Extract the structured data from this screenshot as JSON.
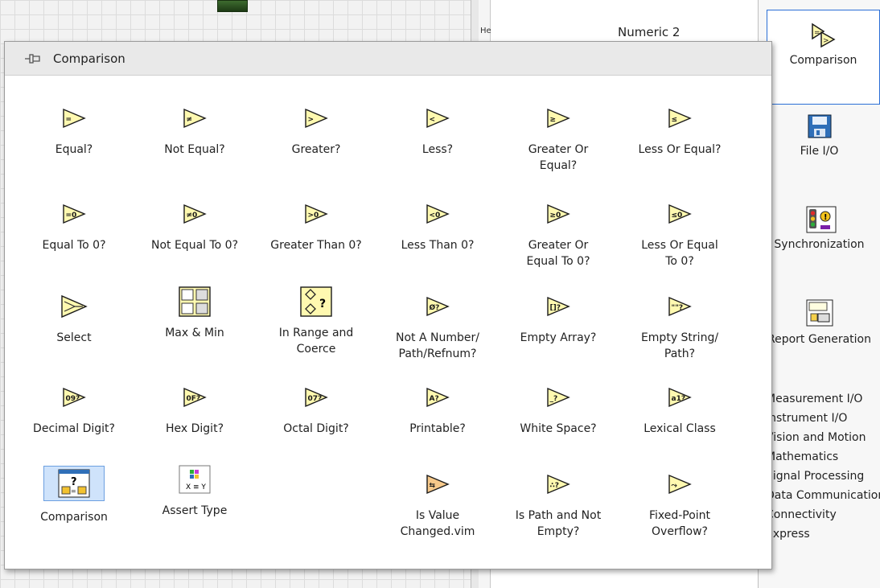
{
  "background": {
    "numeric_label": "Numeric 2",
    "strip_label": "He"
  },
  "popup": {
    "title": "Comparison",
    "items": [
      {
        "label": "Equal?",
        "glyph": "="
      },
      {
        "label": "Not Equal?",
        "glyph": "≠"
      },
      {
        "label": "Greater?",
        "glyph": ">"
      },
      {
        "label": "Less?",
        "glyph": "<"
      },
      {
        "label": "Greater Or Equal?",
        "glyph": "≥"
      },
      {
        "label": "Less Or Equal?",
        "glyph": "≤"
      },
      {
        "label": "Equal To 0?",
        "glyph": "=0"
      },
      {
        "label": "Not Equal To 0?",
        "glyph": "≠0"
      },
      {
        "label": "Greater Than 0?",
        "glyph": ">0"
      },
      {
        "label": "Less Than 0?",
        "glyph": "<0"
      },
      {
        "label": "Greater Or Equal To 0?",
        "glyph": "≥0"
      },
      {
        "label": "Less Or Equal To 0?",
        "glyph": "≤0"
      },
      {
        "label": "Select",
        "glyph": "sel"
      },
      {
        "label": "Max & Min",
        "glyph": "maxmin"
      },
      {
        "label": "In Range and Coerce",
        "glyph": "range"
      },
      {
        "label": "Not A Number/ Path/Refnum?",
        "glyph": "Ø?"
      },
      {
        "label": "Empty Array?",
        "glyph": "[]?"
      },
      {
        "label": "Empty String/ Path?",
        "glyph": "\"\"?"
      },
      {
        "label": "Decimal Digit?",
        "glyph": "09?"
      },
      {
        "label": "Hex Digit?",
        "glyph": "0F?"
      },
      {
        "label": "Octal Digit?",
        "glyph": "07?"
      },
      {
        "label": "Printable?",
        "glyph": "A?"
      },
      {
        "label": "White Space?",
        "glyph": "_?"
      },
      {
        "label": "Lexical Class",
        "glyph": "a1?"
      },
      {
        "label": "Comparison",
        "glyph": "subpal"
      },
      {
        "label": "Assert Type",
        "glyph": "assert"
      },
      {
        "label": "Is Value Changed.vim",
        "glyph": "chg"
      },
      {
        "label": "Is Path and Not Empty?",
        "glyph": "path"
      },
      {
        "label": "Fixed-Point Overflow?",
        "glyph": "fxp"
      }
    ]
  },
  "right_palette": {
    "items": [
      {
        "label": "Comparison",
        "selected": true
      },
      {
        "label": "File I/O"
      },
      {
        "label": "Synchronization"
      },
      {
        "label": "Report Generation"
      }
    ],
    "list": [
      "Measurement I/O",
      "Instrument I/O",
      "Vision and Motion",
      "Mathematics",
      "Signal Processing",
      "Data Communication",
      "Connectivity",
      "Express"
    ]
  },
  "colors": {
    "icon_fill": "#fff9b0",
    "icon_stroke": "#1a1a1a",
    "selection": "#2b6fd6"
  }
}
